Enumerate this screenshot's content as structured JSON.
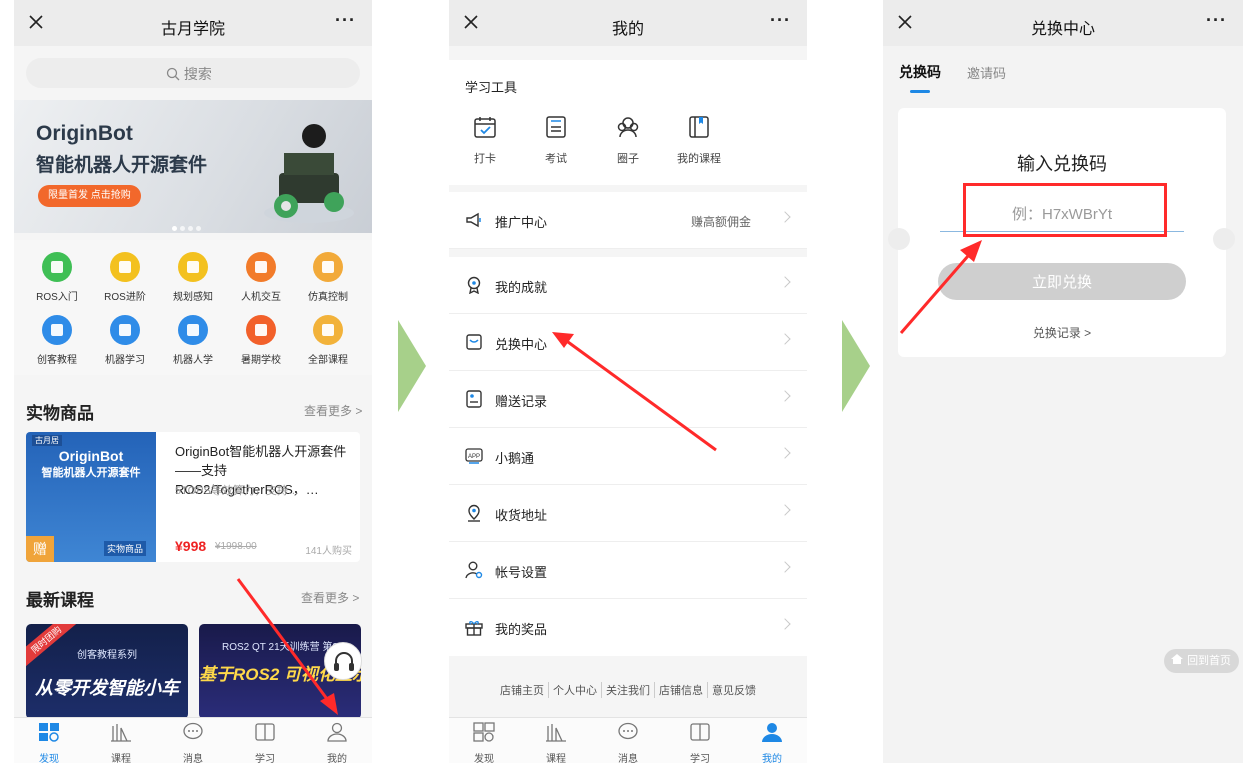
{
  "panel1": {
    "title": "古月学院",
    "more": "···",
    "search_placeholder": "搜索",
    "banner": {
      "title1": "OriginBot",
      "title2": "智能机器人开源套件",
      "button": "限量首发 点击抢购"
    },
    "categories": [
      {
        "label": "ROS入门",
        "color": "#3fbf55"
      },
      {
        "label": "ROS进阶",
        "color": "#f3c11f"
      },
      {
        "label": "规划感知",
        "color": "#f3c11f"
      },
      {
        "label": "人机交互",
        "color": "#f27b2a"
      },
      {
        "label": "仿真控制",
        "color": "#f2aa3a"
      },
      {
        "label": "创客教程",
        "color": "#2f8ce8"
      },
      {
        "label": "机器学习",
        "color": "#2f8ce8"
      },
      {
        "label": "机器人学",
        "color": "#2f8ce8"
      },
      {
        "label": "暑期学校",
        "color": "#f2602a"
      },
      {
        "label": "全部课程",
        "color": "#f2b23a"
      }
    ],
    "goods": {
      "section_title": "实物商品",
      "more": "查看更多 >",
      "image_logo": "古月居",
      "image_title1": "OriginBot",
      "image_title2": "智能机器人开源套件",
      "image_gift": "赠",
      "image_tag": "实物商品",
      "name": "OriginBot智能机器人开源套件——支持ROS2/TogetherROS，…",
      "desc": "5TOPS等效算力，支持…",
      "price": "¥998",
      "old_price": "¥1998.00",
      "sold": "141人购买"
    },
    "courses": {
      "section_title": "最新课程",
      "more": "查看更多 >",
      "items": [
        {
          "tag": "限时团购",
          "subtitle": "创客教程系列",
          "title": "从零开发智能小车"
        },
        {
          "tag": "",
          "subtitle": "ROS2 QT 21天训练营 第3",
          "title": "基于ROS2 可视化显示"
        }
      ]
    },
    "tabs": [
      {
        "label": "发现",
        "active": true
      },
      {
        "label": "课程",
        "active": false
      },
      {
        "label": "消息",
        "active": false
      },
      {
        "label": "学习",
        "active": false
      },
      {
        "label": "我的",
        "active": false
      }
    ]
  },
  "panel2": {
    "title": "我的",
    "more": "···",
    "tools_title": "学习工具",
    "tools": [
      {
        "label": "打卡",
        "icon": "calendar-check-icon"
      },
      {
        "label": "考试",
        "icon": "exam-paper-icon"
      },
      {
        "label": "圈子",
        "icon": "group-icon"
      },
      {
        "label": "我的课程",
        "icon": "notebook-icon"
      }
    ],
    "promo": {
      "label": "推广中心",
      "right": "赚高额佣金"
    },
    "menu": [
      {
        "label": "我的成就",
        "icon": "medal-icon"
      },
      {
        "label": "兑换中心",
        "icon": "exchange-icon"
      },
      {
        "label": "赠送记录",
        "icon": "gift-record-icon"
      },
      {
        "label": "小鹅通",
        "icon": "app-icon"
      },
      {
        "label": "收货地址",
        "icon": "location-icon"
      },
      {
        "label": "帐号设置",
        "icon": "account-settings-icon"
      },
      {
        "label": "我的奖品",
        "icon": "prize-icon"
      }
    ],
    "footer": [
      "店铺主页",
      "个人中心",
      "关注我们",
      "店铺信息",
      "意见反馈"
    ],
    "tabs": [
      {
        "label": "发现",
        "active": false
      },
      {
        "label": "课程",
        "active": false
      },
      {
        "label": "消息",
        "active": false
      },
      {
        "label": "学习",
        "active": false
      },
      {
        "label": "我的",
        "active": true
      }
    ]
  },
  "panel3": {
    "title": "兑换中心",
    "more": "···",
    "tab_active": "兑换码",
    "tab_inactive": "邀请码",
    "card_title": "输入兑换码",
    "input_placeholder": "例：H7xWBrYt",
    "button": "立即兑换",
    "record_link": "兑换记录 >",
    "home_button": "回到首页"
  },
  "colors": {
    "accent_blue": "#1e88e5",
    "annotation_red": "#ff2a2a",
    "chevron_green": "#a7d08a"
  }
}
